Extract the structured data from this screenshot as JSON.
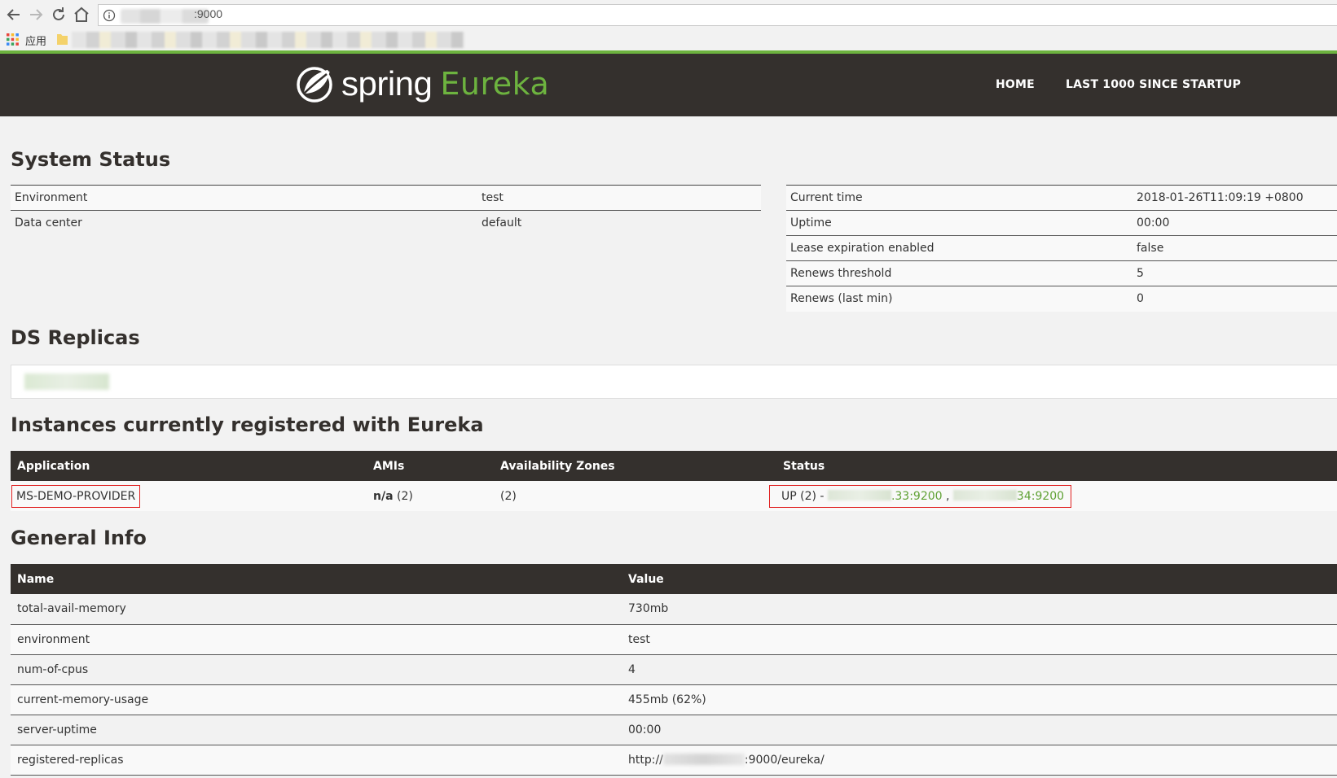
{
  "browser": {
    "url_suffix": ":9000",
    "bookmarks_apps_label": "应用"
  },
  "header": {
    "logo_spring": "spring",
    "logo_eureka": "Eureka",
    "nav": [
      "HOME",
      "LAST 1000 SINCE STARTUP"
    ]
  },
  "colors": {
    "brand_green": "#6db33f",
    "header_bg": "#34302d",
    "highlight_red": "#e02020"
  },
  "system_status": {
    "title": "System Status",
    "left": [
      {
        "key": "Environment",
        "value": "test"
      },
      {
        "key": "Data center",
        "value": "default"
      }
    ],
    "right": [
      {
        "key": "Current time",
        "value": "2018-01-26T11:09:19 +0800"
      },
      {
        "key": "Uptime",
        "value": "00:00"
      },
      {
        "key": "Lease expiration enabled",
        "value": "false"
      },
      {
        "key": "Renews threshold",
        "value": "5"
      },
      {
        "key": "Renews (last min)",
        "value": "0"
      }
    ]
  },
  "ds_replicas": {
    "title": "DS Replicas"
  },
  "instances": {
    "title": "Instances currently registered with Eureka",
    "headers": [
      "Application",
      "AMIs",
      "Availability Zones",
      "Status"
    ],
    "rows": [
      {
        "application": "MS-DEMO-PROVIDER",
        "amis_label": "n/a",
        "amis_count": "(2)",
        "zones": "(2)",
        "status_prefix": "UP (2) -",
        "instance_1_suffix": ".33:9200",
        "separator": ",",
        "instance_2_suffix": "34:9200"
      }
    ]
  },
  "general_info": {
    "title": "General Info",
    "headers": [
      "Name",
      "Value"
    ],
    "rows": [
      {
        "name": "total-avail-memory",
        "value": "730mb"
      },
      {
        "name": "environment",
        "value": "test"
      },
      {
        "name": "num-of-cpus",
        "value": "4"
      },
      {
        "name": "current-memory-usage",
        "value": "455mb (62%)"
      },
      {
        "name": "server-uptime",
        "value": "00:00"
      },
      {
        "name": "registered-replicas",
        "value_prefix": "http://",
        "value_suffix": ":9000/eureka/"
      }
    ]
  }
}
